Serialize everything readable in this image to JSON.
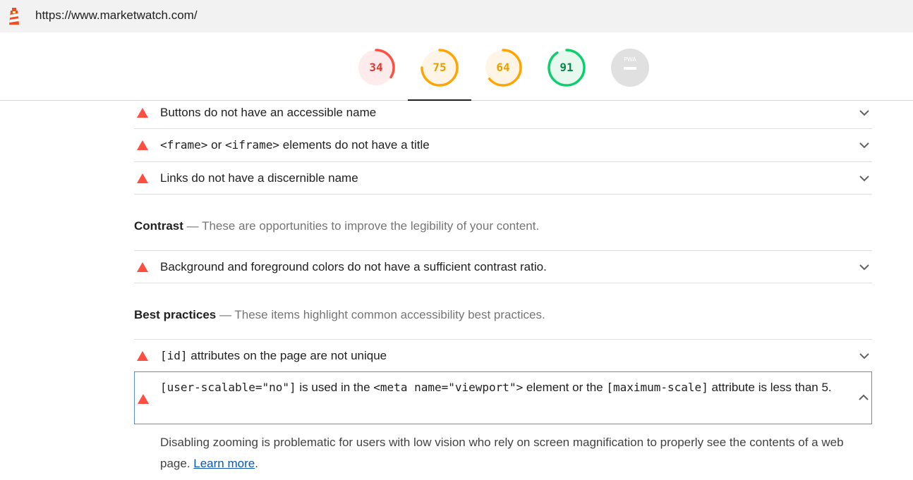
{
  "urlbar": {
    "url": "https://www.marketwatch.com/",
    "logo_icon": "lighthouse-icon"
  },
  "gauges": [
    {
      "score": "34",
      "fraction": 0.34,
      "color": "#ff4e42",
      "fill": "#fdeceb"
    },
    {
      "score": "75",
      "fraction": 0.75,
      "color": "#ffa400",
      "fill": "#fff5e6"
    },
    {
      "score": "64",
      "fraction": 0.64,
      "color": "#ffa400",
      "fill": "#fff5e6"
    },
    {
      "score": "91",
      "fraction": 0.91,
      "color": "#0cce6b",
      "fill": "#e7f9ef"
    },
    {
      "label": "PWA",
      "color": "#b0b0b0",
      "fill": "#e0e0e0"
    }
  ],
  "audits_top": [
    {
      "title": "Buttons do not have an accessible name"
    },
    {
      "title_parts": [
        "<frame>",
        " or ",
        "<iframe>",
        " elements do not have a title"
      ]
    },
    {
      "title": "Links do not have a discernible name"
    }
  ],
  "contrast_group": {
    "title": "Contrast",
    "dash": "—",
    "description": "These are opportunities to improve the legibility of your content."
  },
  "contrast_audit": {
    "title": "Background and foreground colors do not have a sufficient contrast ratio."
  },
  "best_practices_group": {
    "title": "Best practices",
    "dash": "—",
    "description": "These items highlight common accessibility best practices."
  },
  "id_audit": {
    "code": "[id]",
    "title": " attributes on the page are not unique"
  },
  "expanded_audit": {
    "code1": "[user-scalable=\"no\"]",
    "text1": " is used in the ",
    "code2": "<meta name=\"viewport\">",
    "text2": " element or the ",
    "code3": "[maximum-scale]",
    "text3": " attribute is less than 5."
  },
  "details": {
    "text": "Disabling zooming is problematic for users with low vision who rely on screen magnification to properly see the contents of a web page. ",
    "link": "Learn more",
    "period": "."
  },
  "colors": {
    "fail": "#ff4e42",
    "link": "#0b57b0",
    "focus_border": "#5b8dd6"
  }
}
